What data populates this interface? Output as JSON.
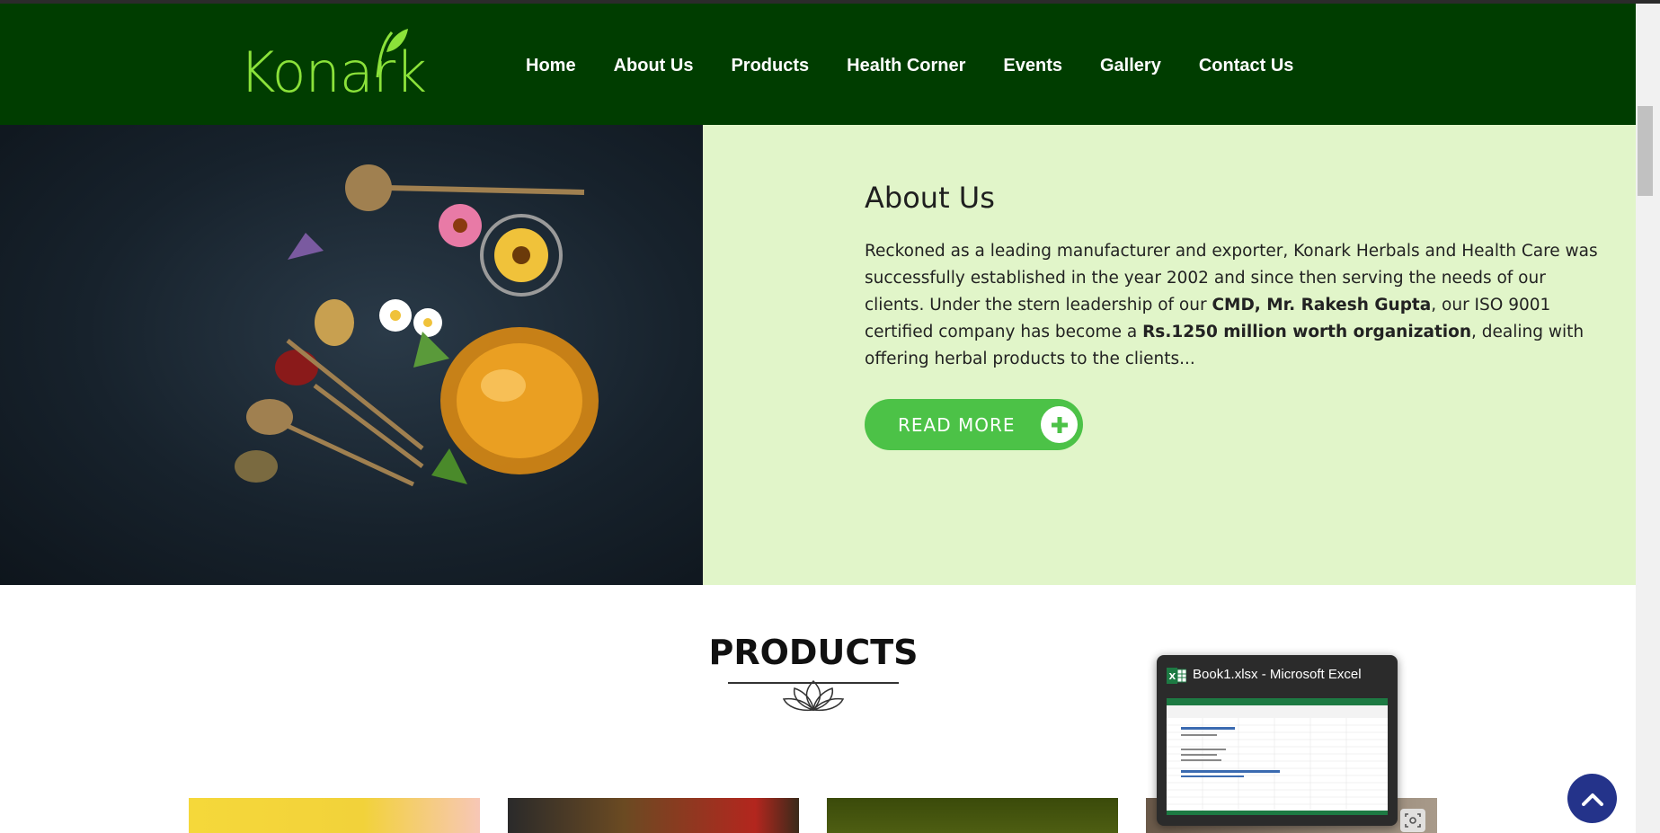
{
  "header": {
    "logo_text": "Konark",
    "nav_items": [
      "Home",
      "About Us",
      "Products",
      "Health Corner",
      "Events",
      "Gallery",
      "Contact Us"
    ]
  },
  "about": {
    "title": "About Us",
    "text_part1": "Reckoned as a leading manufacturer and exporter, Konark Herbals and Health Care was successfully established in the year 2002 and since then serving the needs of our clients. Under the stern leadership of our ",
    "text_bold1": "CMD, Mr. Rakesh Gupta",
    "text_part2": ", our ISO 9001 certified company has become a ",
    "text_bold2": "Rs.1250 million worth organization",
    "text_part3": ", dealing with offering herbal products to the clients...",
    "read_more_label": "READ MORE"
  },
  "products": {
    "title": "PRODUCTS"
  },
  "taskbar_preview": {
    "title": "Book1.xlsx - Microsoft Excel",
    "app_icon": "excel-icon"
  },
  "colors": {
    "nav_bg": "#003d00",
    "logo_green": "#8be23a",
    "about_bg": "#e1f5c9",
    "button_green": "#4cc247",
    "scroll_top_bg": "#24338a"
  },
  "icons": {
    "logo_leaf": "leaf-icon",
    "read_more_plus": "plus-icon",
    "scroll_top": "chevron-up-icon",
    "preview_capture": "screen-capture-icon"
  }
}
